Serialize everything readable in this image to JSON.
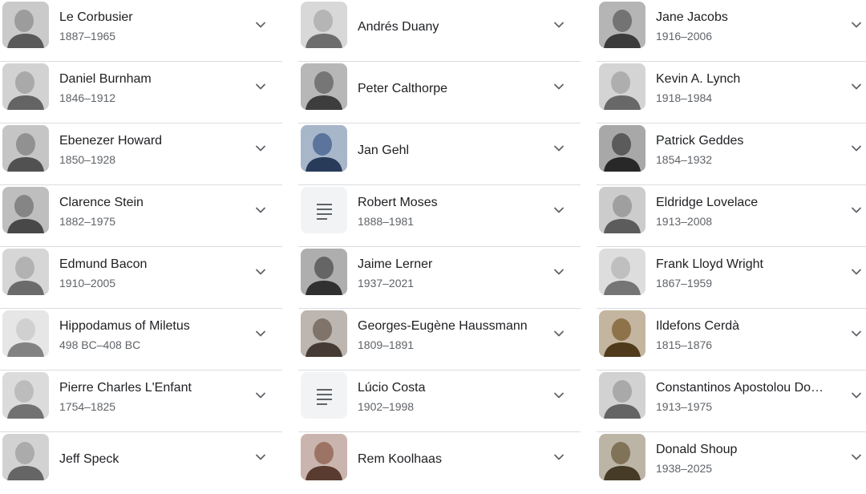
{
  "columns": [
    {
      "items": [
        {
          "name": "Le Corbusier",
          "years": "1887–1965",
          "thumb": "photo",
          "tone": "#8a8a8a"
        },
        {
          "name": "Daniel Burnham",
          "years": "1846–1912",
          "thumb": "photo",
          "tone": "#9a9a9a"
        },
        {
          "name": "Ebenezer Howard",
          "years": "1850–1928",
          "thumb": "photo",
          "tone": "#7d7d7d"
        },
        {
          "name": "Clarence Stein",
          "years": "1882–1975",
          "thumb": "photo",
          "tone": "#6f6f6f"
        },
        {
          "name": "Edmund Bacon",
          "years": "1910–2005",
          "thumb": "photo",
          "tone": "#a4a4a4"
        },
        {
          "name": "Hippodamus of Miletus",
          "years": "498 BC–408 BC",
          "thumb": "photo",
          "tone": "#c8c8c8"
        },
        {
          "name": "Pierre Charles L'Enfant",
          "years": "1754–1825",
          "thumb": "photo",
          "tone": "#b0b0b0"
        },
        {
          "name": "Jeff Speck",
          "years": "",
          "thumb": "photo",
          "tone": "#9c9c9c"
        }
      ]
    },
    {
      "items": [
        {
          "name": "Andrés Duany",
          "years": "",
          "thumb": "photo",
          "tone": "#a8a8a8"
        },
        {
          "name": "Peter Calthorpe",
          "years": "",
          "thumb": "photo",
          "tone": "#5e5e5e"
        },
        {
          "name": "Jan Gehl",
          "years": "",
          "thumb": "photo",
          "tone": "#3d5c8a"
        },
        {
          "name": "Robert Moses",
          "years": "1888–1981",
          "thumb": "doc",
          "tone": "#f1f3f4"
        },
        {
          "name": "Jaime Lerner",
          "years": "1937–2021",
          "thumb": "photo",
          "tone": "#4a4a4a"
        },
        {
          "name": "Georges-Eugène Haussmann",
          "years": "1809–1891",
          "thumb": "photo",
          "tone": "#6a5a50"
        },
        {
          "name": "Lúcio Costa",
          "years": "1902–1998",
          "thumb": "doc",
          "tone": "#f1f3f4"
        },
        {
          "name": "Rem Koolhaas",
          "years": "",
          "thumb": "photo",
          "tone": "#8a5a4a"
        }
      ]
    },
    {
      "items": [
        {
          "name": "Jane Jacobs",
          "years": "1916–2006",
          "thumb": "photo",
          "tone": "#5a5a5a"
        },
        {
          "name": "Kevin A. Lynch",
          "years": "1918–1984",
          "thumb": "photo",
          "tone": "#a0a0a0"
        },
        {
          "name": "Patrick Geddes",
          "years": "1854–1932",
          "thumb": "photo",
          "tone": "#3e3e3e"
        },
        {
          "name": "Eldridge Lovelace",
          "years": "1913–2008",
          "thumb": "photo",
          "tone": "#8e8e8e"
        },
        {
          "name": "Frank Lloyd Wright",
          "years": "1867–1959",
          "thumb": "photo",
          "tone": "#b4b4b4"
        },
        {
          "name": "Ildefons Cerdà",
          "years": "1815–1876",
          "thumb": "photo",
          "tone": "#7a5a2a"
        },
        {
          "name": "Constantinos Apostolou Doxi…",
          "years": "1913–1975",
          "thumb": "photo",
          "tone": "#9a9a9a"
        },
        {
          "name": "Donald Shoup",
          "years": "1938–2025",
          "thumb": "photo",
          "tone": "#6b5a3a"
        }
      ]
    }
  ],
  "icons": {
    "chevron": "chevron-down-icon",
    "doc": "document-icon",
    "photo": "person-photo-icon"
  },
  "colors": {
    "divider": "#dadce0",
    "name": "#202124",
    "years": "#5f6368",
    "chevron": "#5f6368",
    "doc_bg": "#f1f3f4"
  }
}
